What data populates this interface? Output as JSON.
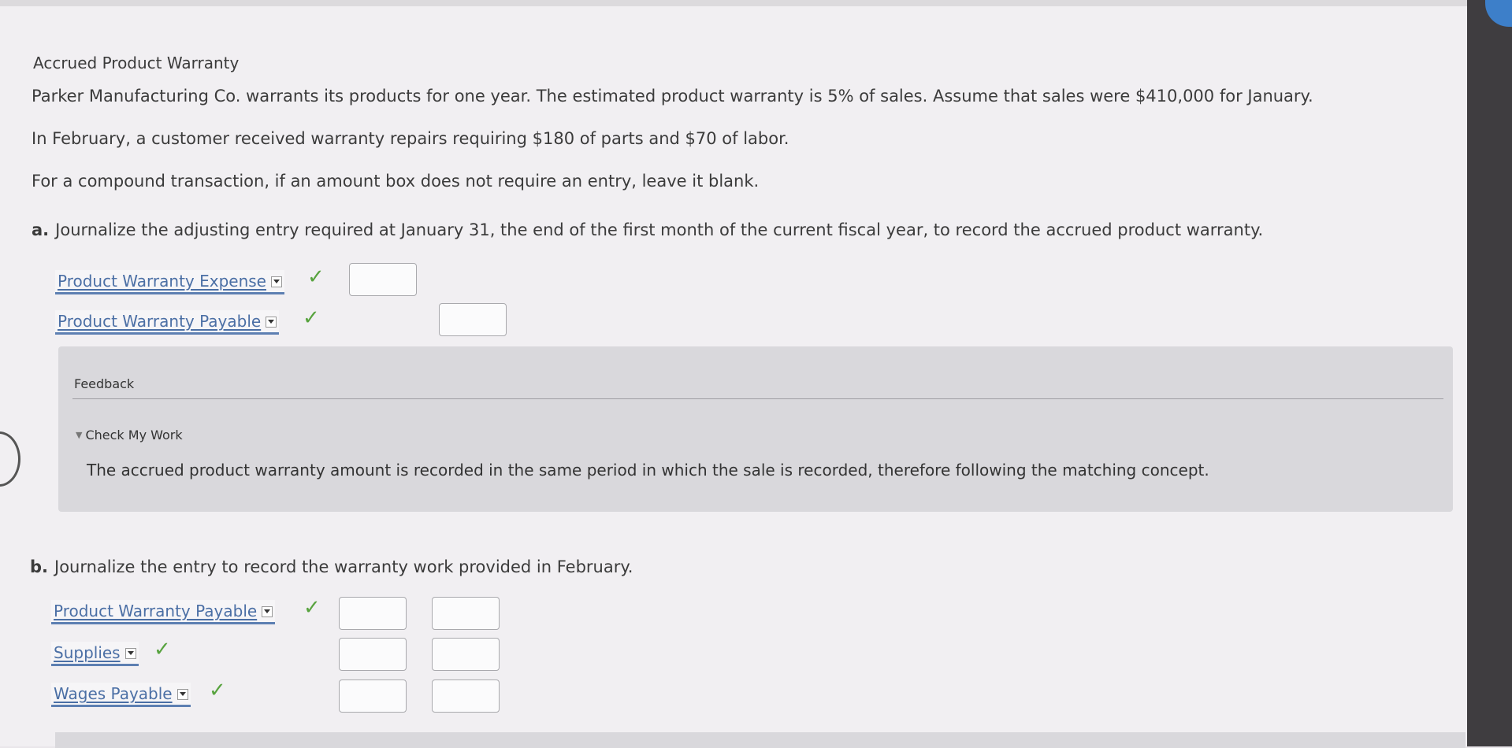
{
  "problem": {
    "title": "Accrued Product Warranty",
    "p1": "Parker Manufacturing Co. warrants its products for one year. The estimated product warranty is 5% of sales. Assume that sales were $410,000 for January.",
    "p2": "In February, a customer received warranty repairs requiring $180 of parts and $70 of labor.",
    "p3": "For a compound transaction, if an amount box does not require an entry, leave it blank."
  },
  "part_a": {
    "label": "a.",
    "question": "Journalize the adjusting entry required at January 31, the end of the first month of the current fiscal year, to record the accrued product warranty.",
    "rows": [
      {
        "account": "Product Warranty Expense",
        "debit": "",
        "credit": null
      },
      {
        "account": "Product Warranty Payable",
        "debit": null,
        "credit": ""
      }
    ]
  },
  "feedback": {
    "title": "Feedback",
    "toggle": "Check My Work",
    "text": "The accrued product warranty amount is recorded in the same period in which the sale is recorded, therefore following the matching concept."
  },
  "part_b": {
    "label": "b.",
    "question": "Journalize the entry to record the warranty work provided in February.",
    "rows": [
      {
        "account": "Product Warranty Payable",
        "debit": "",
        "credit": ""
      },
      {
        "account": "Supplies",
        "debit": "",
        "credit": ""
      },
      {
        "account": "Wages Payable",
        "debit": "",
        "credit": ""
      }
    ]
  },
  "check_mark": "✓",
  "colors": {
    "check": "#58a33f",
    "link": "#4b6fa5",
    "feedback_bg": "#d9d8dc"
  }
}
